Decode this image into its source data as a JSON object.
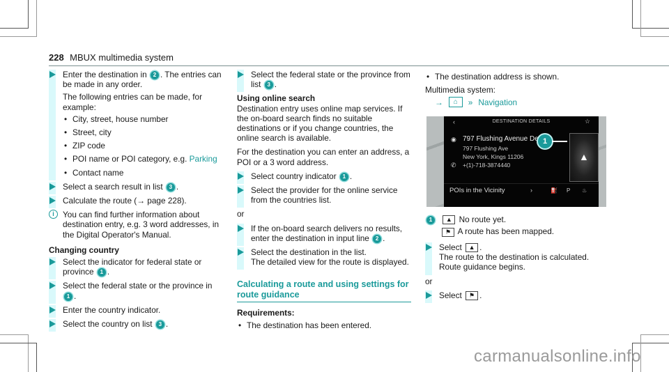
{
  "header": {
    "page_number": "228",
    "section_title": "MBUX multimedia system"
  },
  "col1": {
    "step1": {
      "text_a": "Enter the destination in",
      "badge": "2",
      "text_b": ". The entries can be made in any order."
    },
    "step1_para": "The following entries can be made, for example:",
    "entries": [
      "City, street, house number",
      "Street, city",
      "ZIP code",
      "POI name or POI category, e.g.",
      "Contact name"
    ],
    "entries_link": "Parking",
    "step2": {
      "text_a": "Select a search result in list",
      "badge": "3",
      "text_b": "."
    },
    "step3": "Calculate the route (→ page 228).",
    "info": "You can find further information about destination entry, e.g. 3 word addresses, in the Digital Operator's Manual.",
    "changing_country_heading": "Changing country",
    "cc_step1": {
      "text_a": "Select the indicator for federal state or province",
      "badge": "1",
      "text_b": "."
    },
    "cc_step2": {
      "text_a": "Select the federal state or the province in",
      "badge": "1",
      "text_b": "."
    },
    "cc_step3": "Enter the country indicator.",
    "cc_step4": {
      "text_a": "Select the country on list",
      "badge": "3",
      "text_b": "."
    }
  },
  "col2": {
    "step1": {
      "text_a": "Select the federal state or the province from list",
      "badge": "3",
      "text_b": "."
    },
    "online_heading": "Using online search",
    "online_para1": "Destination entry uses online map services. If the on-board search finds no suitable destinations or if you change countries, the online search is available.",
    "online_para2": "For the destination you can enter an address, a POI or a 3 word address.",
    "step2": {
      "text_a": "Select country indicator",
      "badge": "1",
      "text_b": "."
    },
    "step3": "Select the provider for the online service from the countries list.",
    "or_label": "or",
    "step4": {
      "text_a": "If the on-board search delivers no results, enter the destination in input line",
      "badge": "2",
      "text_b": "."
    },
    "step5_a": "Select the destination in the list.",
    "step5_b": "The detailed view for the route is displayed.",
    "calc_heading": "Calculating a route and using settings for route guidance",
    "req_heading": "Requirements:",
    "req_item": "The destination has been entered."
  },
  "col3": {
    "req_item2": "The destination address is shown.",
    "system_label": "Multimedia system:",
    "nav_path": {
      "arrow": "→",
      "home_icon": "⌂",
      "double_chevron": "»",
      "link": "Navigation"
    },
    "screen": {
      "title": "DESTINATION DETAILS",
      "back": "‹",
      "star": "☆",
      "poi_name": "797 Flushing Avenue Deli",
      "street": "797 Flushing Ave",
      "city": "New York, Kings 11206",
      "phone": "+(1)-718-3874440",
      "pois_label": "POIs in the Vicinity",
      "chevron": "›",
      "callout": "1"
    },
    "legend": [
      {
        "badge": "1",
        "icon": "▲",
        "text": "No route yet."
      },
      {
        "icon": "⚑",
        "text": "A route has been mapped."
      }
    ],
    "step1_prefix": "Select",
    "step1_icon": "▲",
    "step1_result_a": "The route to the destination is calculated.",
    "step1_result_b": "Route guidance begins.",
    "or_label": "or",
    "step2_prefix": "Select",
    "step2_icon": "⚑"
  },
  "watermark": "carmanualsonline.info"
}
